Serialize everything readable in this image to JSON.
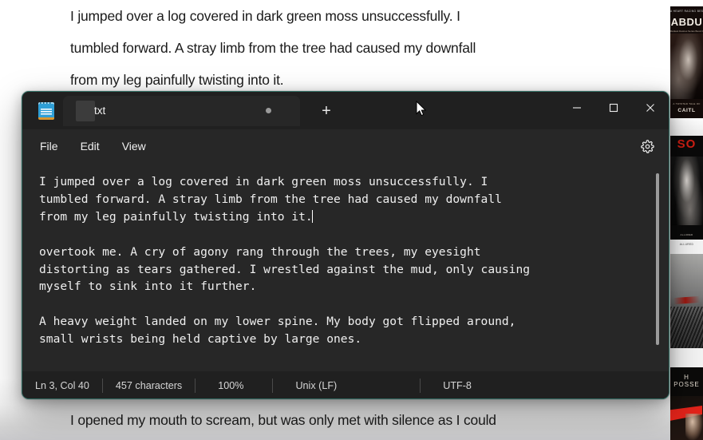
{
  "background_page": {
    "top_paragraph_lines": [
      "I jumped over a log covered in dark green moss unsuccessfully. I",
      "tumbled forward. A stray limb from the tree had caused my downfall",
      "from my leg painfully twisting into it."
    ],
    "bottom_paragraph_lines": [
      "I opened my mouth to scream, but was only met with silence as I could"
    ],
    "text_color": "#1b1b1b",
    "page_color": "#ffffff"
  },
  "covers_rail": [
    {
      "name": "abducted-cover",
      "top_label": "A HEART RACING BESTSELLER",
      "title": "ABDU",
      "subtitle": "Darkest Desires Series Book One",
      "footer_small": "A TWISTED TALE OF",
      "footer": "CAITL",
      "background": "#140c0a"
    },
    {
      "name": "white-spacer-cover",
      "title": "",
      "background": "#ffffff"
    },
    {
      "name": "sold-cover",
      "title": "SO",
      "footer_small": "ALLURED",
      "background": "#0a0a0a"
    },
    {
      "name": "cityscape-cover",
      "top_label": "ALLURED",
      "title": "",
      "background": "#f4f4f4"
    },
    {
      "name": "possession-cover",
      "title": "H",
      "subtitle": "POSSE",
      "background": "#0c0b0a"
    }
  ],
  "notepad": {
    "app_icon_name": "notepad-icon",
    "tab": {
      "redacted_filename": "",
      "title": "txt",
      "modified_indicator": "●"
    },
    "new_tab_label": "+",
    "window_controls": {
      "minimize": "Minimize",
      "maximize": "Maximize",
      "close": "Close"
    },
    "menu": {
      "file": "File",
      "edit": "Edit",
      "view": "View",
      "settings": "Settings"
    },
    "editor": {
      "content": "I jumped over a log covered in dark green moss unsuccessfully. I\ntumbled forward. A stray limb from the tree had caused my downfall\nfrom my leg painfully twisting into it.\n\novertook me. A cry of agony rang through the trees, my eyesight\ndistorting as tears gathered. I wrestled against the mud, only causing\nmyself to sink into it further.\n\nA heavy weight landed on my lower spine. My body got flipped around,\nsmall wrists being held captive by large ones.",
      "text_color": "#efefef",
      "background_color": "#272727"
    },
    "status_bar": {
      "position": "Ln 3, Col 40",
      "character_count": "457 characters",
      "zoom": "100%",
      "line_endings": "Unix (LF)",
      "encoding": "UTF-8"
    },
    "accent_border_color": "#2f6b61",
    "chrome_color": "#202020"
  }
}
